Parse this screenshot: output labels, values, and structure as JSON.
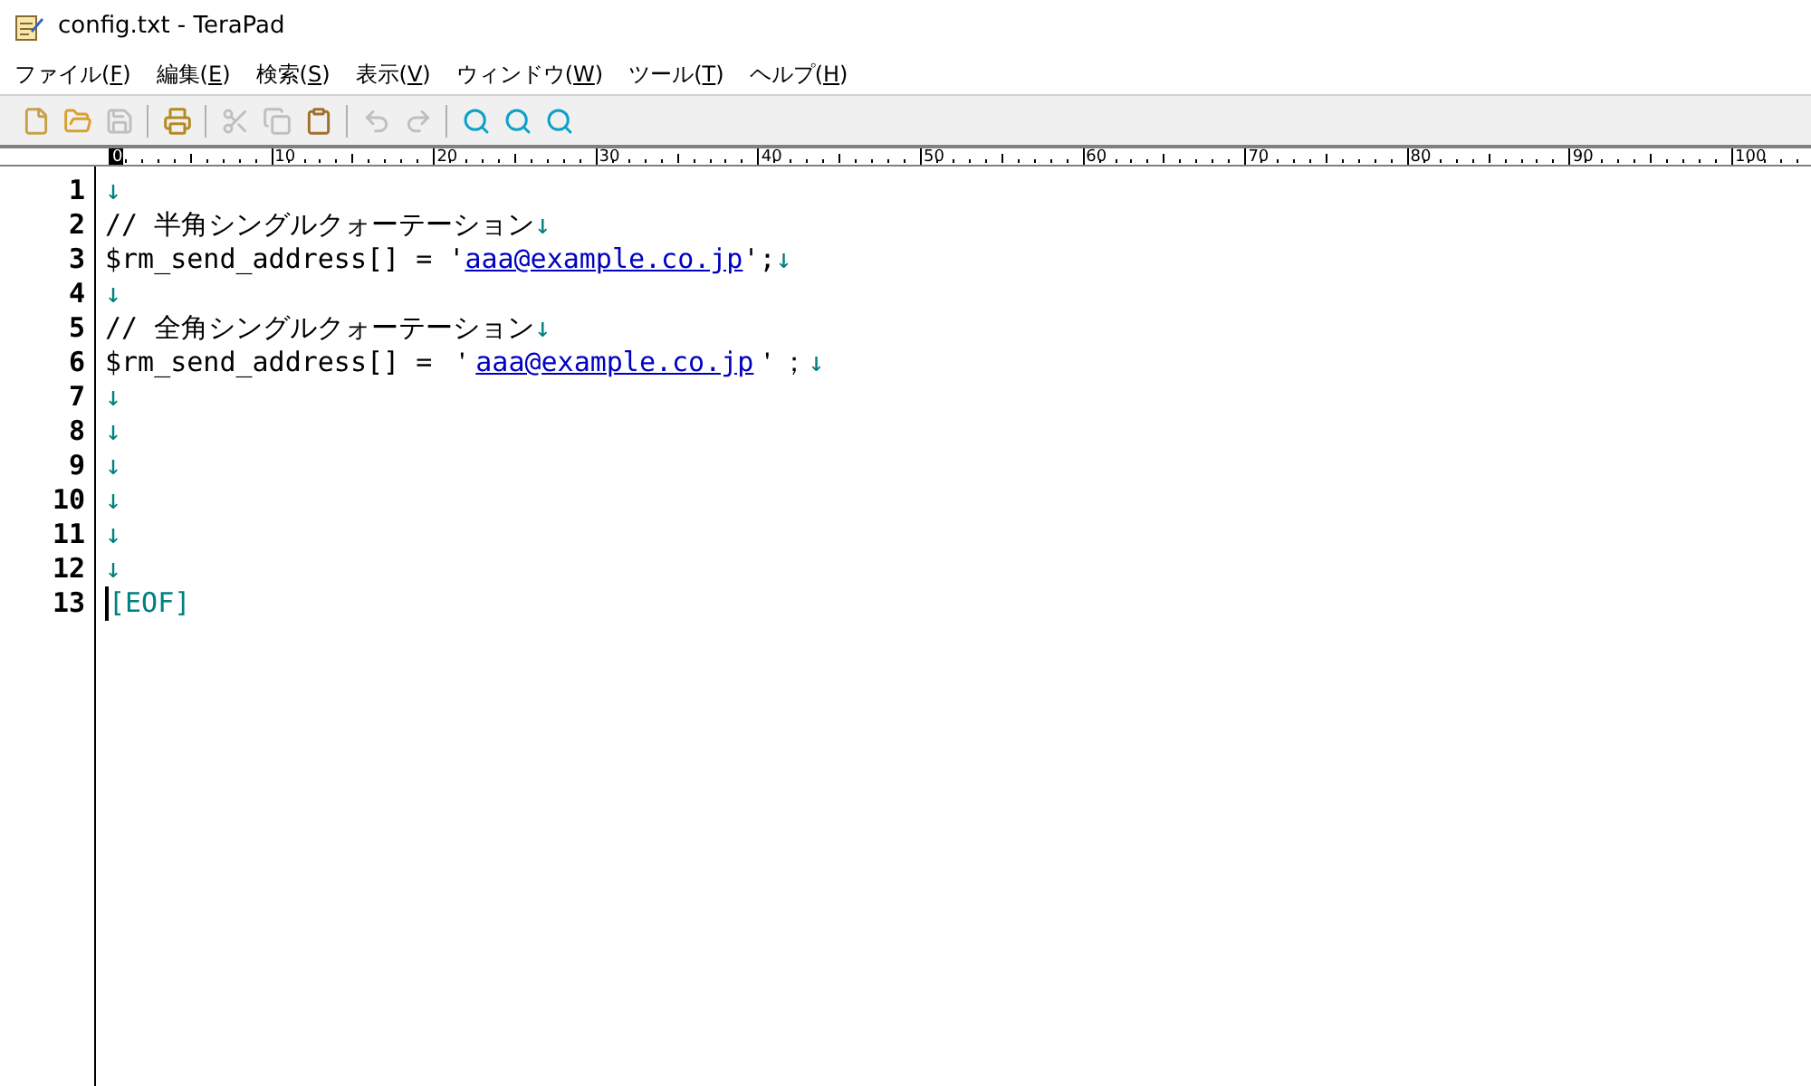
{
  "window": {
    "title": "config.txt - TeraPad"
  },
  "menu": [
    {
      "label": "ファイル(F)"
    },
    {
      "label": "編集(E)"
    },
    {
      "label": "検索(S)"
    },
    {
      "label": "表示(V)"
    },
    {
      "label": "ウィンドウ(W)"
    },
    {
      "label": "ツール(T)"
    },
    {
      "label": "ヘルプ(H)"
    }
  ],
  "toolbar": [
    [
      {
        "kind": "new",
        "disabled": false
      },
      {
        "kind": "open",
        "disabled": false
      },
      {
        "kind": "save",
        "disabled": true
      }
    ],
    [
      {
        "kind": "print",
        "disabled": false
      }
    ],
    [
      {
        "kind": "cut",
        "disabled": true
      },
      {
        "kind": "copy",
        "disabled": true
      },
      {
        "kind": "paste",
        "disabled": false
      }
    ],
    [
      {
        "kind": "undo",
        "disabled": true
      },
      {
        "kind": "redo",
        "disabled": true
      }
    ],
    [
      {
        "kind": "find",
        "disabled": false
      },
      {
        "kind": "find-prev",
        "disabled": false
      },
      {
        "kind": "find-next",
        "disabled": false
      }
    ]
  ],
  "ruler": [
    "0",
    "10",
    "20",
    "30",
    "40",
    "50",
    "60",
    "70",
    "80",
    "90",
    "100"
  ],
  "lines": [
    {
      "number": "1",
      "parts": [
        {
          "kind": "newline",
          "text": "↓"
        }
      ]
    },
    {
      "number": "2",
      "parts": [
        {
          "kind": "plain",
          "text": "// 半角シングルクォーテーション"
        },
        {
          "kind": "newline",
          "text": "↓"
        }
      ]
    },
    {
      "number": "3",
      "parts": [
        {
          "kind": "plain",
          "text": "$rm_send_address[] = '"
        },
        {
          "kind": "link",
          "text": "aaa@example.co.jp"
        },
        {
          "kind": "plain",
          "text": "';"
        },
        {
          "kind": "newline",
          "text": "↓"
        }
      ]
    },
    {
      "number": "4",
      "parts": [
        {
          "kind": "newline",
          "text": "↓"
        }
      ]
    },
    {
      "number": "5",
      "parts": [
        {
          "kind": "plain",
          "text": "// 全角シングルクォーテーション"
        },
        {
          "kind": "newline",
          "text": "↓"
        }
      ]
    },
    {
      "number": "6",
      "parts": [
        {
          "kind": "plain",
          "text": "$rm_send_address[] = ＇"
        },
        {
          "kind": "link",
          "text": "aaa@example.co.jp"
        },
        {
          "kind": "plain",
          "text": "＇；"
        },
        {
          "kind": "newline",
          "text": "↓"
        }
      ]
    },
    {
      "number": "7",
      "parts": [
        {
          "kind": "newline",
          "text": "↓"
        }
      ]
    },
    {
      "number": "8",
      "parts": [
        {
          "kind": "newline",
          "text": "↓"
        }
      ]
    },
    {
      "number": "9",
      "parts": [
        {
          "kind": "newline",
          "text": "↓"
        }
      ]
    },
    {
      "number": "10",
      "parts": [
        {
          "kind": "newline",
          "text": "↓"
        }
      ]
    },
    {
      "number": "11",
      "parts": [
        {
          "kind": "newline",
          "text": "↓"
        }
      ]
    },
    {
      "number": "12",
      "parts": [
        {
          "kind": "newline",
          "text": "↓"
        }
      ]
    },
    {
      "number": "13",
      "parts": [
        {
          "kind": "eof",
          "text": "[EOF]"
        }
      ]
    }
  ]
}
